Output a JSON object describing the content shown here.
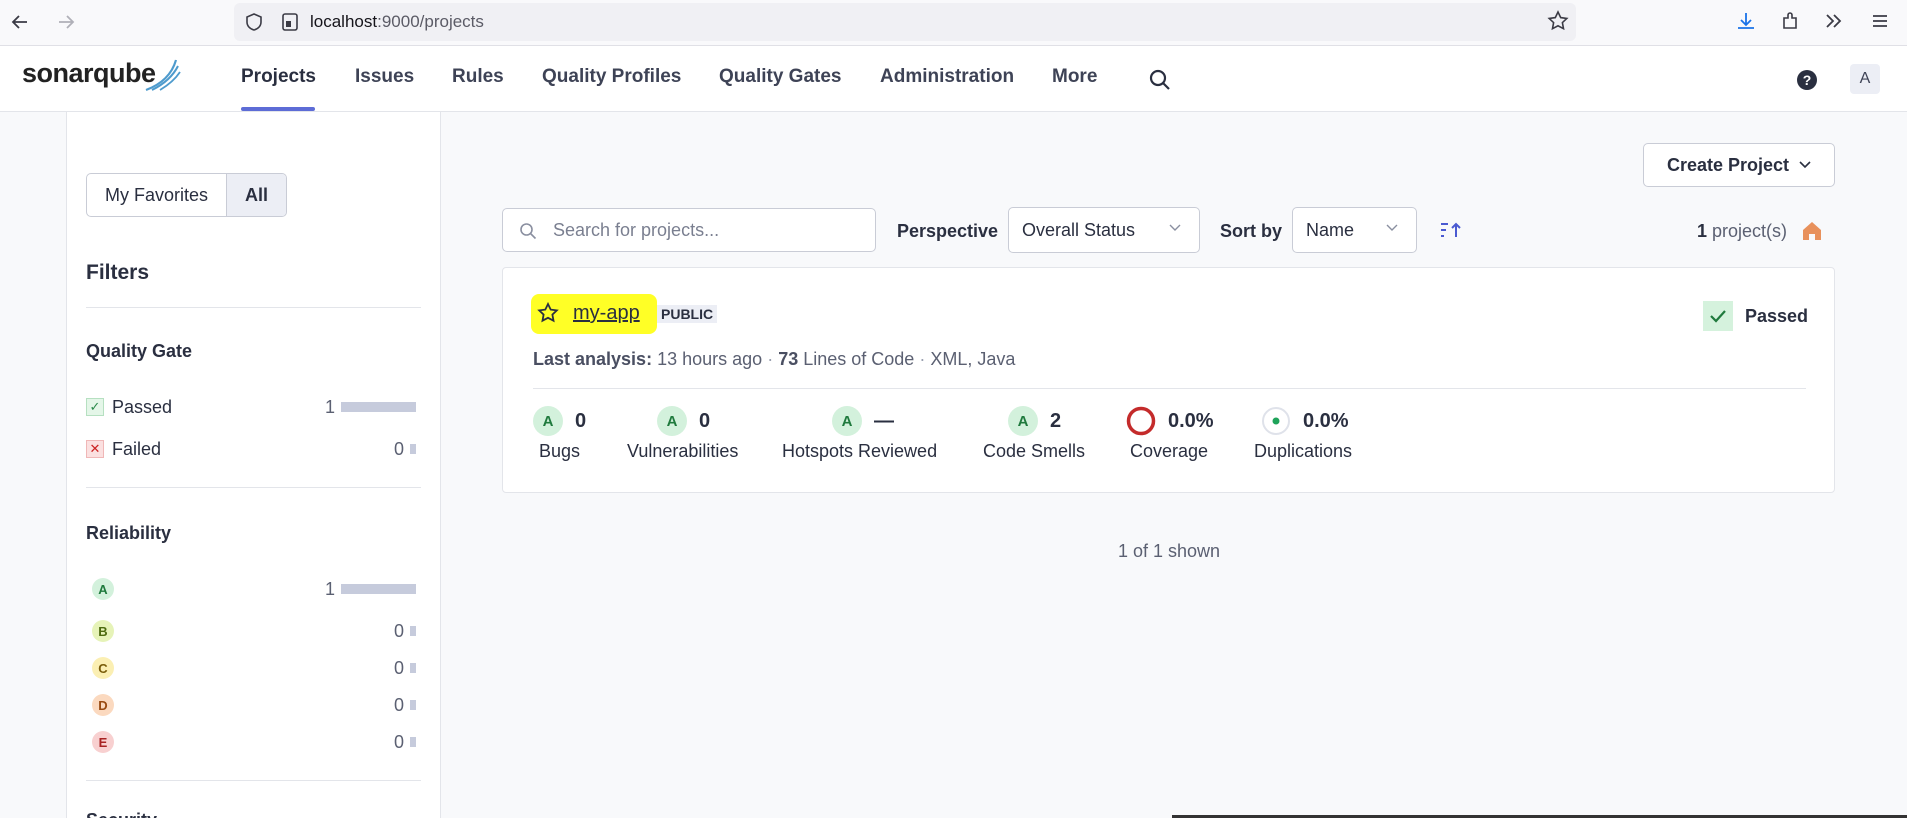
{
  "browser": {
    "url_host": "localhost",
    "url_rest": ":9000/projects"
  },
  "app": {
    "logo_text": "sonarqube",
    "nav": [
      "Projects",
      "Issues",
      "Rules",
      "Quality Profiles",
      "Quality Gates",
      "Administration",
      "More"
    ],
    "avatar_letter": "A"
  },
  "sidebar": {
    "toggle": [
      "My Favorites",
      "All"
    ],
    "filters_title": "Filters",
    "quality_gate": {
      "title": "Quality Gate",
      "items": [
        {
          "label": "Passed",
          "count": "1"
        },
        {
          "label": "Failed",
          "count": "0"
        }
      ]
    },
    "reliability": {
      "title": "Reliability",
      "items": [
        {
          "grade": "A",
          "count": "1"
        },
        {
          "grade": "B",
          "count": "0"
        },
        {
          "grade": "C",
          "count": "0"
        },
        {
          "grade": "D",
          "count": "0"
        },
        {
          "grade": "E",
          "count": "0"
        }
      ]
    },
    "next_section": "Security"
  },
  "toolbar": {
    "create_project": "Create Project",
    "search_placeholder": "Search for projects...",
    "perspective_label": "Perspective",
    "perspective_value": "Overall Status",
    "sortby_label": "Sort by",
    "sortby_value": "Name",
    "count_number": "1",
    "count_suffix": "project(s)"
  },
  "project": {
    "name": "my-app",
    "visibility": "PUBLIC",
    "last_analysis_label": "Last analysis:",
    "last_analysis_value": "13 hours ago",
    "loc_number": "73",
    "loc_label": "Lines of Code",
    "languages": "XML, Java",
    "status": "Passed",
    "measures": {
      "bugs": {
        "grade": "A",
        "value": "0",
        "label": "Bugs"
      },
      "vulnerabilities": {
        "grade": "A",
        "value": "0",
        "label": "Vulnerabilities"
      },
      "hotspots": {
        "grade": "A",
        "value": "—",
        "label": "Hotspots Reviewed"
      },
      "code_smells": {
        "grade": "A",
        "value": "2",
        "label": "Code Smells"
      },
      "coverage": {
        "value": "0.0%",
        "label": "Coverage"
      },
      "duplications": {
        "value": "0.0%",
        "label": "Duplications"
      }
    }
  },
  "footer": {
    "shown_text": "1 of 1 shown"
  },
  "colors": {
    "accent": "#5d6cd6",
    "highlight": "#ffff00",
    "passed_bg": "#d5f2dd",
    "coverage_ring": "#c42b2b",
    "home_icon": "#e8915c"
  }
}
